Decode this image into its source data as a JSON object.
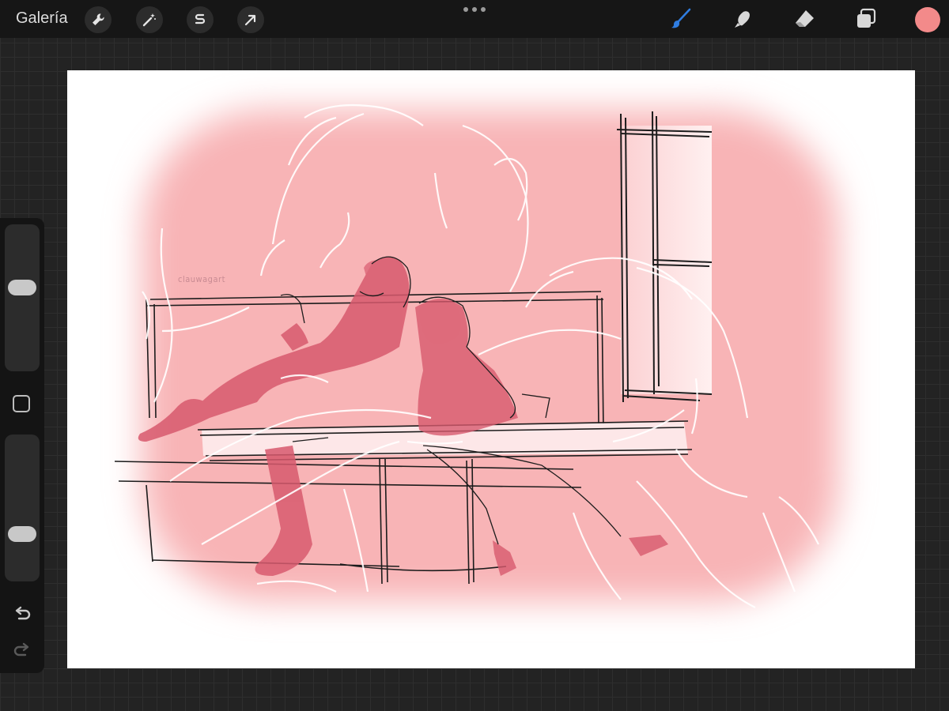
{
  "topbar": {
    "gallery_label": "Galería",
    "left_tools": [
      "wrench-icon",
      "magic-wand-icon",
      "selection-icon",
      "transform-arrow-icon"
    ],
    "right_tools": [
      "brush-icon",
      "smudge-icon",
      "eraser-icon",
      "layers-icon"
    ],
    "active_tool": "brush-icon",
    "active_tool_color": "#2f7de1",
    "current_color": "#f38a8a"
  },
  "sidebar": {
    "brush_size": 0.58,
    "opacity": 0.29
  },
  "canvas": {
    "watermark": "clauwagart",
    "background_color": "#ffffff",
    "wash_color": "#f8b4b6",
    "sketch_color": "#1c1c1c",
    "figure_color": "#d85a6e"
  }
}
